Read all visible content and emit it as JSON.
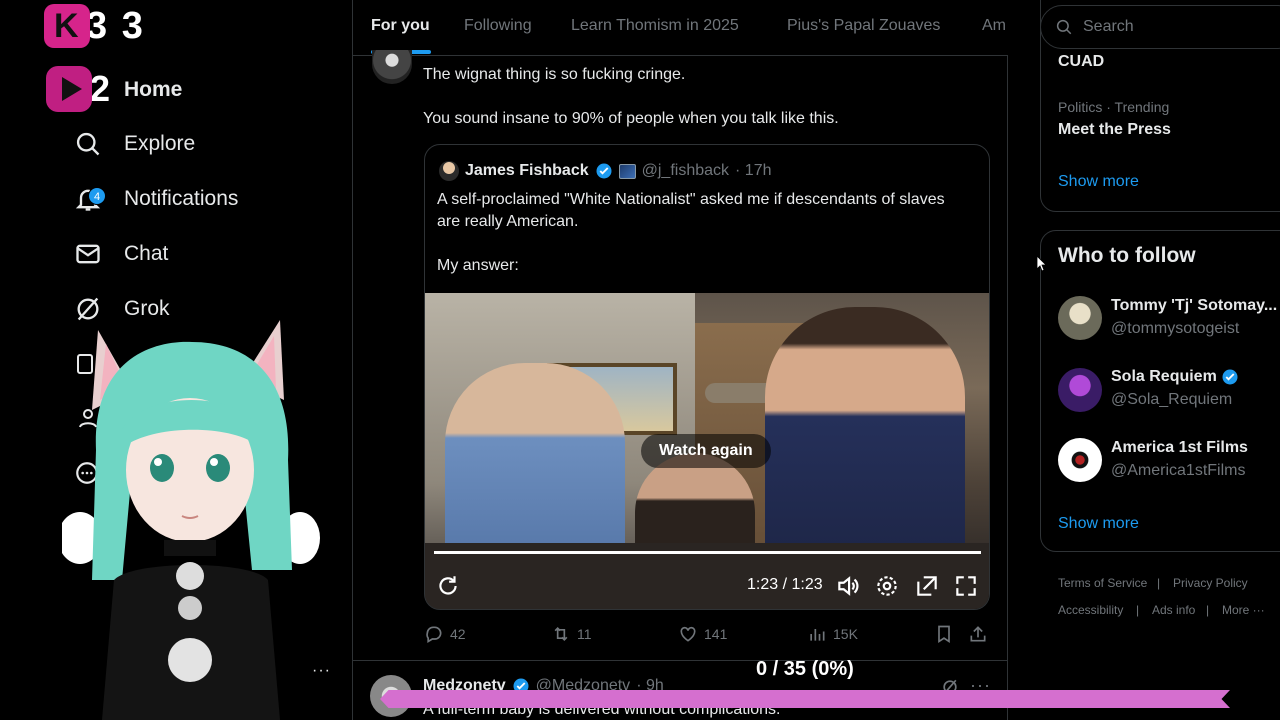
{
  "brand": {
    "overlay_count": "3 3",
    "overlay_count2": "2"
  },
  "nav": {
    "home": "Home",
    "explore": "Explore",
    "notifications": "Notifications",
    "notifications_badge": "4",
    "chat": "Chat",
    "grok": "Grok"
  },
  "tabs": [
    "For you",
    "Following",
    "Learn Thomism in 2025",
    "Pius's Papal Zouaves",
    "Am"
  ],
  "post": {
    "line1": "The wignat thing is so fucking cringe.",
    "line2": "You sound insane to 90% of people when you talk like this.",
    "quote": {
      "name": "James Fishback",
      "handle": "@j_fishback",
      "time": "· 17h",
      "text1": "A self-proclaimed \"White Nationalist\" asked me if descendants of slaves are really American.",
      "text2": "My answer:"
    },
    "video": {
      "watch_again": "Watch again",
      "time": "1:23 / 1:23",
      "progress": 1.0
    },
    "actions": {
      "replies": "42",
      "reposts": "11",
      "likes": "141",
      "views": "15K"
    }
  },
  "next_post": {
    "name": "Medzonetv",
    "handle": "@Medzonetv",
    "time": "· 9h",
    "text": "A full-term baby is delivered without complications."
  },
  "overlay": {
    "progress_label": "0 / 35 (0%)",
    "progress_fraction": 0.0
  },
  "search": {
    "placeholder": "Search"
  },
  "trends": {
    "top_name": "CUAD",
    "item_meta": "Politics · Trending",
    "item_name": "Meet the Press",
    "show_more": "Show more"
  },
  "who_to_follow": {
    "title": "Who to follow",
    "accounts": [
      {
        "name": "Tommy 'Tj' Sotomay...",
        "handle": "@tommysotogeist",
        "verified": false
      },
      {
        "name": "Sola Requiem",
        "handle": "@Sola_Requiem",
        "verified": true
      },
      {
        "name": "America 1st Films",
        "handle": "@America1stFilms",
        "verified": false
      }
    ],
    "show_more": "Show more"
  },
  "footer": {
    "terms": "Terms of Service",
    "privacy": "Privacy Policy",
    "accessibility": "Accessibility",
    "ads": "Ads info",
    "more": "More ···"
  },
  "colors": {
    "accent": "#1d9bf0",
    "brand_pink": "#d6248b",
    "overlay_bar": "#d56fcf"
  }
}
